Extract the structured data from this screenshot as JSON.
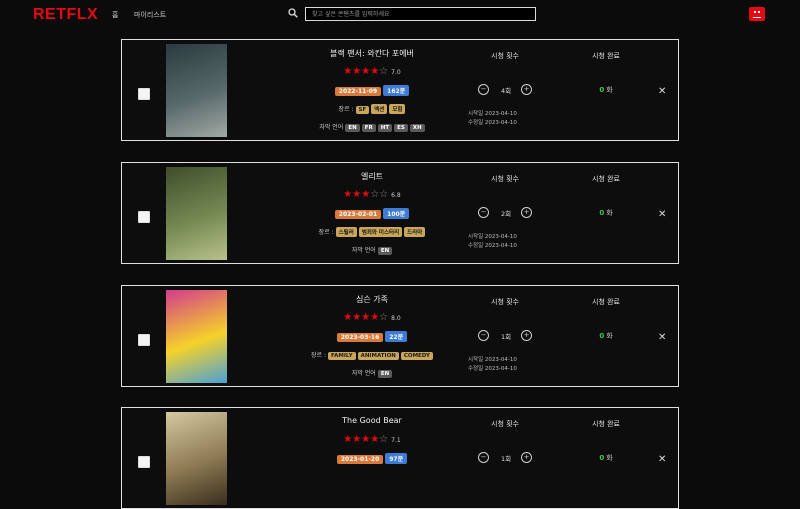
{
  "app": {
    "logo": "RETFLX",
    "nav": [
      "홈",
      "마이리스트"
    ]
  },
  "search": {
    "placeholder": "찾고 싶은 콘텐츠를 입력하세요"
  },
  "labels": {
    "watch_count": "시청 횟수",
    "watched_episodes": "시청 완료",
    "genre": "장르",
    "language": "자막 언어",
    "episode_unit": "화",
    "started": "시작일",
    "updated": "수정일"
  },
  "cards": [
    {
      "title": "블랙 팬서: 와칸다 포에버",
      "rating": 3.5,
      "score": "7.0",
      "release_date": "2022-11-09",
      "runtime": "162분",
      "genres": [
        "SF",
        "액션",
        "모험"
      ],
      "languages": [
        "EN",
        "FR",
        "HT",
        "ES",
        "XH"
      ],
      "watch_count": "4회",
      "watched_episodes": "0",
      "start_line": "시작일 2023-04-10",
      "update_line": "수정일 2023-04-10",
      "poster_colors": [
        "#2a3a3e",
        "#57686a",
        "#a1a9a4"
      ]
    },
    {
      "title": "엘리트",
      "rating": 3,
      "score": "6.8",
      "release_date": "2023-02-01",
      "runtime": "100분",
      "genres": [
        "스릴러",
        "범죄와 미스터리",
        "드라마"
      ],
      "languages": [
        "EN"
      ],
      "watch_count": "2회",
      "watched_episodes": "0",
      "start_line": "시작일 2023-04-10",
      "update_line": "수정일 2023-04-10",
      "poster_colors": [
        "#3f4d2b",
        "#758852",
        "#b8c28a"
      ]
    },
    {
      "title": "심슨 가족",
      "rating": 3.5,
      "score": "8.0",
      "release_date": "2023-03-16",
      "runtime": "22분",
      "genres": [
        "FAMILY",
        "ANIMATION",
        "COMEDY"
      ],
      "languages": [
        "EN"
      ],
      "watch_count": "1회",
      "watched_episodes": "0",
      "start_line": "시작일 2023-04-10",
      "update_line": "수정일 2023-04-10",
      "poster_colors": [
        "#d33c8c",
        "#f5d22a",
        "#4aa0d8"
      ]
    },
    {
      "title": "The Good Bear",
      "rating": 3.5,
      "score": "7.1",
      "release_date": "2023-01-20",
      "runtime": "97분",
      "genres": [],
      "languages": [],
      "watch_count": "1회",
      "watched_episodes": "0",
      "start_line": "",
      "update_line": "",
      "poster_colors": [
        "#d6c8a0",
        "#8c7a52",
        "#3a2e1e"
      ]
    }
  ],
  "colors": {
    "accent": "#e50914",
    "date": "#d97a3a",
    "runtime": "#3d7bd5",
    "genre": "#c9a65a",
    "watched": "#3cc84a"
  }
}
